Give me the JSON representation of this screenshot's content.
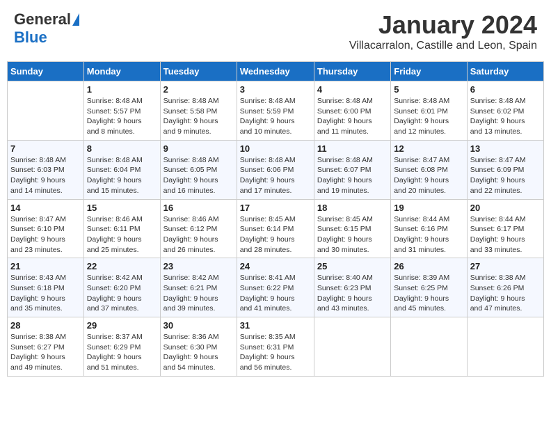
{
  "header": {
    "logo_general": "General",
    "logo_blue": "Blue",
    "month_year": "January 2024",
    "location": "Villacarralon, Castille and Leon, Spain"
  },
  "columns": [
    "Sunday",
    "Monday",
    "Tuesday",
    "Wednesday",
    "Thursday",
    "Friday",
    "Saturday"
  ],
  "weeks": [
    [
      {
        "day": "",
        "info": ""
      },
      {
        "day": "1",
        "info": "Sunrise: 8:48 AM\nSunset: 5:57 PM\nDaylight: 9 hours\nand 8 minutes."
      },
      {
        "day": "2",
        "info": "Sunrise: 8:48 AM\nSunset: 5:58 PM\nDaylight: 9 hours\nand 9 minutes."
      },
      {
        "day": "3",
        "info": "Sunrise: 8:48 AM\nSunset: 5:59 PM\nDaylight: 9 hours\nand 10 minutes."
      },
      {
        "day": "4",
        "info": "Sunrise: 8:48 AM\nSunset: 6:00 PM\nDaylight: 9 hours\nand 11 minutes."
      },
      {
        "day": "5",
        "info": "Sunrise: 8:48 AM\nSunset: 6:01 PM\nDaylight: 9 hours\nand 12 minutes."
      },
      {
        "day": "6",
        "info": "Sunrise: 8:48 AM\nSunset: 6:02 PM\nDaylight: 9 hours\nand 13 minutes."
      }
    ],
    [
      {
        "day": "7",
        "info": "Sunrise: 8:48 AM\nSunset: 6:03 PM\nDaylight: 9 hours\nand 14 minutes."
      },
      {
        "day": "8",
        "info": "Sunrise: 8:48 AM\nSunset: 6:04 PM\nDaylight: 9 hours\nand 15 minutes."
      },
      {
        "day": "9",
        "info": "Sunrise: 8:48 AM\nSunset: 6:05 PM\nDaylight: 9 hours\nand 16 minutes."
      },
      {
        "day": "10",
        "info": "Sunrise: 8:48 AM\nSunset: 6:06 PM\nDaylight: 9 hours\nand 17 minutes."
      },
      {
        "day": "11",
        "info": "Sunrise: 8:48 AM\nSunset: 6:07 PM\nDaylight: 9 hours\nand 19 minutes."
      },
      {
        "day": "12",
        "info": "Sunrise: 8:47 AM\nSunset: 6:08 PM\nDaylight: 9 hours\nand 20 minutes."
      },
      {
        "day": "13",
        "info": "Sunrise: 8:47 AM\nSunset: 6:09 PM\nDaylight: 9 hours\nand 22 minutes."
      }
    ],
    [
      {
        "day": "14",
        "info": "Sunrise: 8:47 AM\nSunset: 6:10 PM\nDaylight: 9 hours\nand 23 minutes."
      },
      {
        "day": "15",
        "info": "Sunrise: 8:46 AM\nSunset: 6:11 PM\nDaylight: 9 hours\nand 25 minutes."
      },
      {
        "day": "16",
        "info": "Sunrise: 8:46 AM\nSunset: 6:12 PM\nDaylight: 9 hours\nand 26 minutes."
      },
      {
        "day": "17",
        "info": "Sunrise: 8:45 AM\nSunset: 6:14 PM\nDaylight: 9 hours\nand 28 minutes."
      },
      {
        "day": "18",
        "info": "Sunrise: 8:45 AM\nSunset: 6:15 PM\nDaylight: 9 hours\nand 30 minutes."
      },
      {
        "day": "19",
        "info": "Sunrise: 8:44 AM\nSunset: 6:16 PM\nDaylight: 9 hours\nand 31 minutes."
      },
      {
        "day": "20",
        "info": "Sunrise: 8:44 AM\nSunset: 6:17 PM\nDaylight: 9 hours\nand 33 minutes."
      }
    ],
    [
      {
        "day": "21",
        "info": "Sunrise: 8:43 AM\nSunset: 6:18 PM\nDaylight: 9 hours\nand 35 minutes."
      },
      {
        "day": "22",
        "info": "Sunrise: 8:42 AM\nSunset: 6:20 PM\nDaylight: 9 hours\nand 37 minutes."
      },
      {
        "day": "23",
        "info": "Sunrise: 8:42 AM\nSunset: 6:21 PM\nDaylight: 9 hours\nand 39 minutes."
      },
      {
        "day": "24",
        "info": "Sunrise: 8:41 AM\nSunset: 6:22 PM\nDaylight: 9 hours\nand 41 minutes."
      },
      {
        "day": "25",
        "info": "Sunrise: 8:40 AM\nSunset: 6:23 PM\nDaylight: 9 hours\nand 43 minutes."
      },
      {
        "day": "26",
        "info": "Sunrise: 8:39 AM\nSunset: 6:25 PM\nDaylight: 9 hours\nand 45 minutes."
      },
      {
        "day": "27",
        "info": "Sunrise: 8:38 AM\nSunset: 6:26 PM\nDaylight: 9 hours\nand 47 minutes."
      }
    ],
    [
      {
        "day": "28",
        "info": "Sunrise: 8:38 AM\nSunset: 6:27 PM\nDaylight: 9 hours\nand 49 minutes."
      },
      {
        "day": "29",
        "info": "Sunrise: 8:37 AM\nSunset: 6:29 PM\nDaylight: 9 hours\nand 51 minutes."
      },
      {
        "day": "30",
        "info": "Sunrise: 8:36 AM\nSunset: 6:30 PM\nDaylight: 9 hours\nand 54 minutes."
      },
      {
        "day": "31",
        "info": "Sunrise: 8:35 AM\nSunset: 6:31 PM\nDaylight: 9 hours\nand 56 minutes."
      },
      {
        "day": "",
        "info": ""
      },
      {
        "day": "",
        "info": ""
      },
      {
        "day": "",
        "info": ""
      }
    ]
  ]
}
